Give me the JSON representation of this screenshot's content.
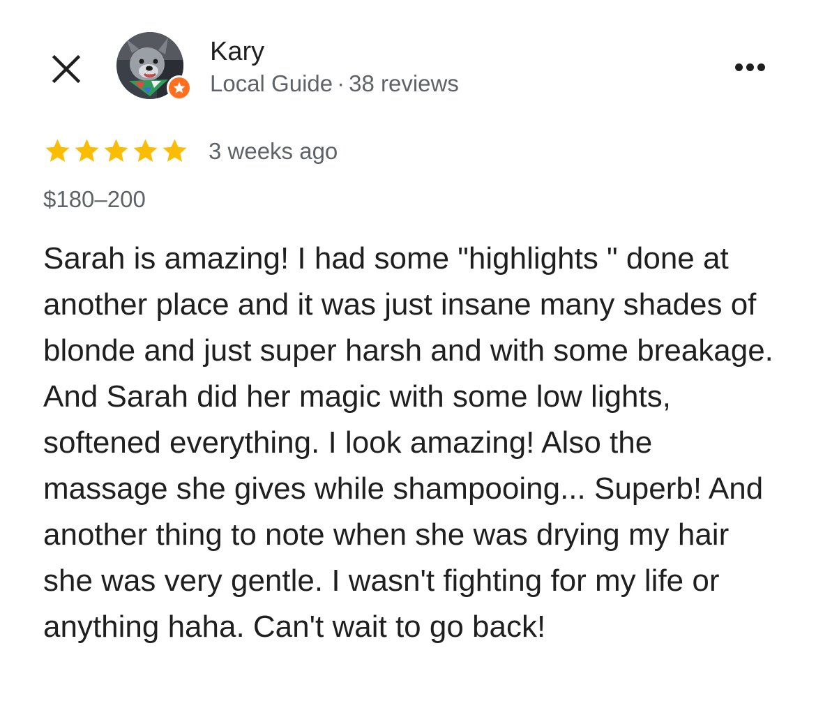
{
  "header": {
    "close_icon": "close-icon",
    "reviewer": {
      "name": "Kary",
      "badge_label": "Local Guide",
      "separator": "·",
      "review_count": "38 reviews",
      "badge_icon": "star-badge-icon",
      "badge_color": "#ff6f1f"
    },
    "more_icon": "more-options-icon"
  },
  "review": {
    "rating": 5,
    "rating_max": 5,
    "star_color": "#fbbc04",
    "time_ago": "3 weeks ago",
    "price_range": "$180–200",
    "text": "Sarah is amazing! I had some \"highlights \" done at another place and it was just insane many shades of blonde and just super harsh and with some breakage. And Sarah did her magic with some low lights, softened everything. I look amazing! Also the massage she gives while shampooing... Superb! And another thing to note when she was drying my hair she was very gentle. I wasn't fighting for my life or anything haha. Can't wait to go back!"
  },
  "colors": {
    "primary_text": "#1f1f1f",
    "secondary_text": "#5f6368",
    "background": "#ffffff"
  }
}
